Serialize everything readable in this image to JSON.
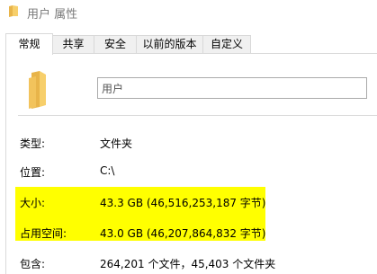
{
  "window": {
    "title": "用户 属性"
  },
  "tabs": [
    {
      "label": "常规",
      "active": true
    },
    {
      "label": "共享",
      "active": false
    },
    {
      "label": "安全",
      "active": false
    },
    {
      "label": "以前的版本",
      "active": false
    },
    {
      "label": "自定义",
      "active": false
    }
  ],
  "general": {
    "folder_name": "用户",
    "type_label": "类型:",
    "type_value": "文件夹",
    "location_label": "位置:",
    "location_value": "C:\\",
    "size_label": "大小:",
    "size_value": "43.3 GB (46,516,253,187 字节)",
    "size_on_disk_label": "占用空间:",
    "size_on_disk_value": "43.0 GB (46,207,864,832 字节)",
    "contains_label": "包含:",
    "contains_value": "264,201 个文件，45,403 个文件夹"
  },
  "colors": {
    "highlight": "#ffff00",
    "folder": "#f7cf6b",
    "folder_dark": "#e8b44a"
  },
  "icons": {
    "title": "folder-icon",
    "main": "folder-icon"
  }
}
